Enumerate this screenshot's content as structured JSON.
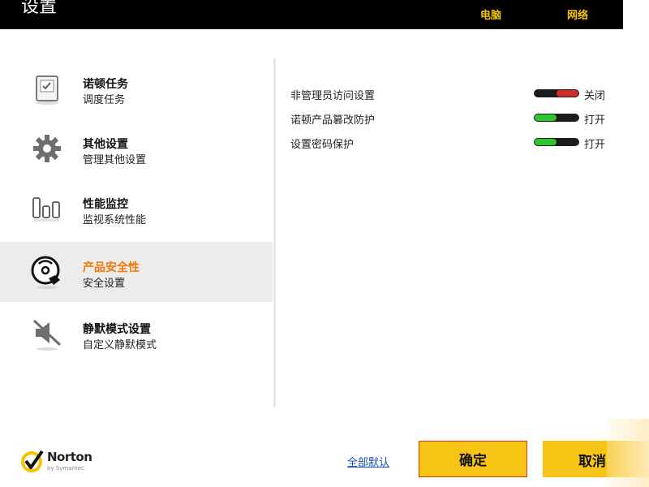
{
  "window": {
    "title": "设置"
  },
  "header_tabs": [
    {
      "label": "电脑"
    },
    {
      "label": "网络"
    }
  ],
  "sidebar": {
    "items": [
      {
        "title": "诺顿任务",
        "subtitle": "调度任务",
        "icon": "task-checklist-icon",
        "active": false
      },
      {
        "title": "其他设置",
        "subtitle": "管理其他设置",
        "icon": "gear-icon",
        "active": false
      },
      {
        "title": "性能监控",
        "subtitle": "监视系统性能",
        "icon": "performance-bars-icon",
        "active": false
      },
      {
        "title": "产品安全性",
        "subtitle": "安全设置",
        "icon": "disc-shield-icon",
        "active": true
      },
      {
        "title": "静默模式设置",
        "subtitle": "自定义静默模式",
        "icon": "mute-speaker-icon",
        "active": false
      }
    ]
  },
  "settings": [
    {
      "label": "非管理员访问设置",
      "state": "关闭",
      "on": false
    },
    {
      "label": "诺顿产品篡改防护",
      "state": "打开",
      "on": true
    },
    {
      "label": "设置密码保护",
      "state": "打开",
      "on": true
    }
  ],
  "footer": {
    "logo": {
      "word": "Norton",
      "byline": "by Symantec"
    },
    "defaults_link": "全部默认",
    "ok_label": "确定",
    "cancel_label": "取消"
  },
  "colors": {
    "header_bg": "#000000",
    "tab_text": "#f5c400",
    "active_item_text": "#f07800",
    "button_bg": "#f7c416",
    "toggle_on": "#2ec52e",
    "toggle_off": "#d42a2a"
  }
}
